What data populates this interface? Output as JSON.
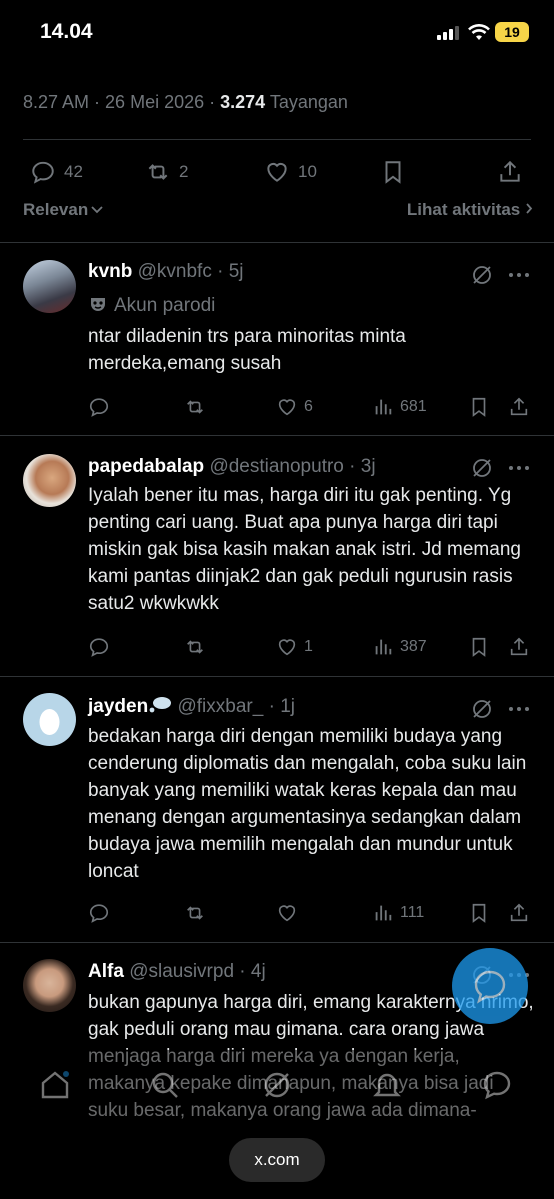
{
  "status_bar": {
    "time": "14.04",
    "battery": "19"
  },
  "tweet_meta": {
    "time": "8.27 AM",
    "sep1": " · ",
    "date": "26 Mei 2026",
    "sep2": " · ",
    "views": "3.274",
    "views_label": "Tayangan"
  },
  "tweet_actions": {
    "replies": "42",
    "reposts": "2",
    "likes": "10"
  },
  "sort": {
    "label": "Relevan",
    "activity": "Lihat aktivitas"
  },
  "replies": [
    {
      "name": "kvnb",
      "handle": "@kvnbfc",
      "age": "5j",
      "badge": "Akun parodi",
      "text": "ntar diladenin trs para minoritas minta merdeka,emang susah",
      "replies": "",
      "reposts": "",
      "likes": "6",
      "views": "681"
    },
    {
      "name": "papedabalap",
      "handle": "@destianoputro",
      "age": "3j",
      "text": "Iyalah bener itu mas, harga diri itu gak penting. Yg penting cari uang. Buat apa punya harga diri tapi miskin gak bisa kasih makan anak istri. Jd memang kami pantas diinjak2 dan gak peduli ngurusin rasis satu2 wkwkwkk",
      "replies": "",
      "reposts": "",
      "likes": "1",
      "views": "387"
    },
    {
      "name": "jayden",
      "handle": "@fixxbar_",
      "age": "1j",
      "text": "bedakan harga diri dengan memiliki budaya yang cenderung diplomatis dan mengalah, coba suku lain banyak yang memiliki watak keras kepala dan mau menang dengan argumentasinya sedangkan dalam budaya jawa memilih mengalah dan mundur untuk loncat",
      "replies": "",
      "reposts": "",
      "likes": "",
      "views": "111"
    },
    {
      "name": "Alfa",
      "handle": "@slausivrpd",
      "age": "4j",
      "text": "bukan gapunya harga diri, emang karakternya nrimo, gak peduli orang mau gimana. cara orang jawa menjaga harga diri mereka ya dengan kerja, makanya kepake dimanapun, makanya bisa jadi suku besar, makanya orang jawa ada dimana-"
    }
  ],
  "browser": {
    "url": "x.com"
  },
  "colors": {
    "background": "#000000",
    "text": "#e7e9ea",
    "muted": "#71767b",
    "accent": "#1d9bf0",
    "battery": "#f7d548"
  }
}
